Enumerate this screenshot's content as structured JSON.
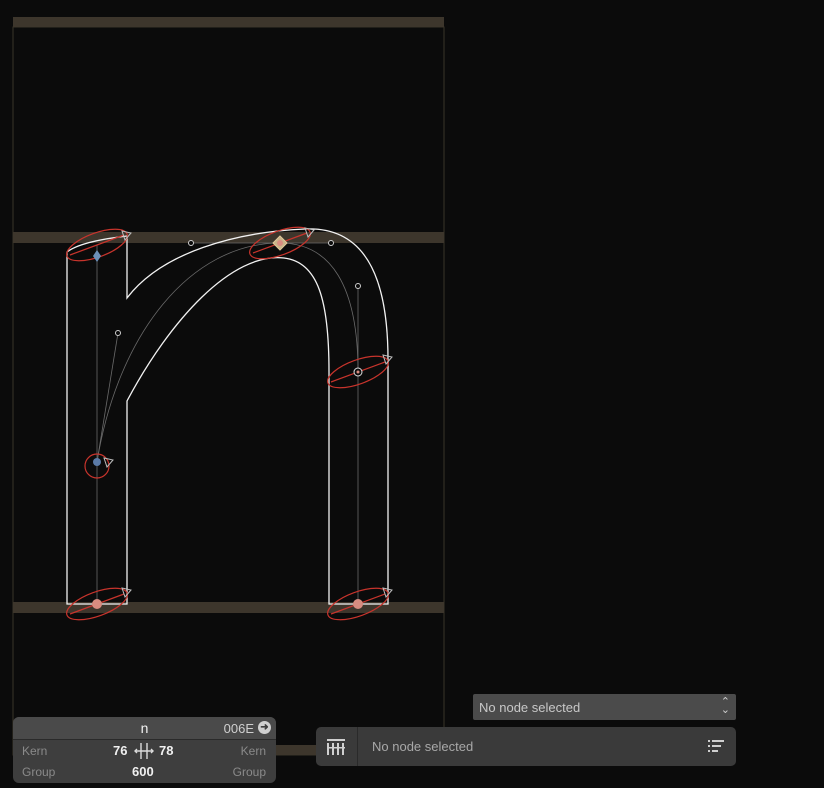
{
  "glyph": {
    "character": "n",
    "unicode": "006E",
    "goto_icon": "arrow-right-circle-icon",
    "left_kern_label": "Kern",
    "left_sidebearing": "76",
    "right_sidebearing": "78",
    "right_kern_label": "Kern",
    "left_group_label": "Group",
    "advance_width": "600",
    "right_group_label": "Group",
    "link_icon": "sidebearing-link-icon"
  },
  "node_select": {
    "value": "No node selected",
    "chevron_icon": "up-down-chevron-icon"
  },
  "node_bar": {
    "logo_icon": "font-editor-logo-icon",
    "text": "No node selected",
    "list_icon": "list-icon"
  },
  "colors": {
    "background": "#0b0b0b",
    "metric_band": "#3d362c",
    "outline": "#ffffff",
    "handle_red": "#c8342c",
    "node_salmon": "#d88c80",
    "panel": "#3e3e3e"
  }
}
